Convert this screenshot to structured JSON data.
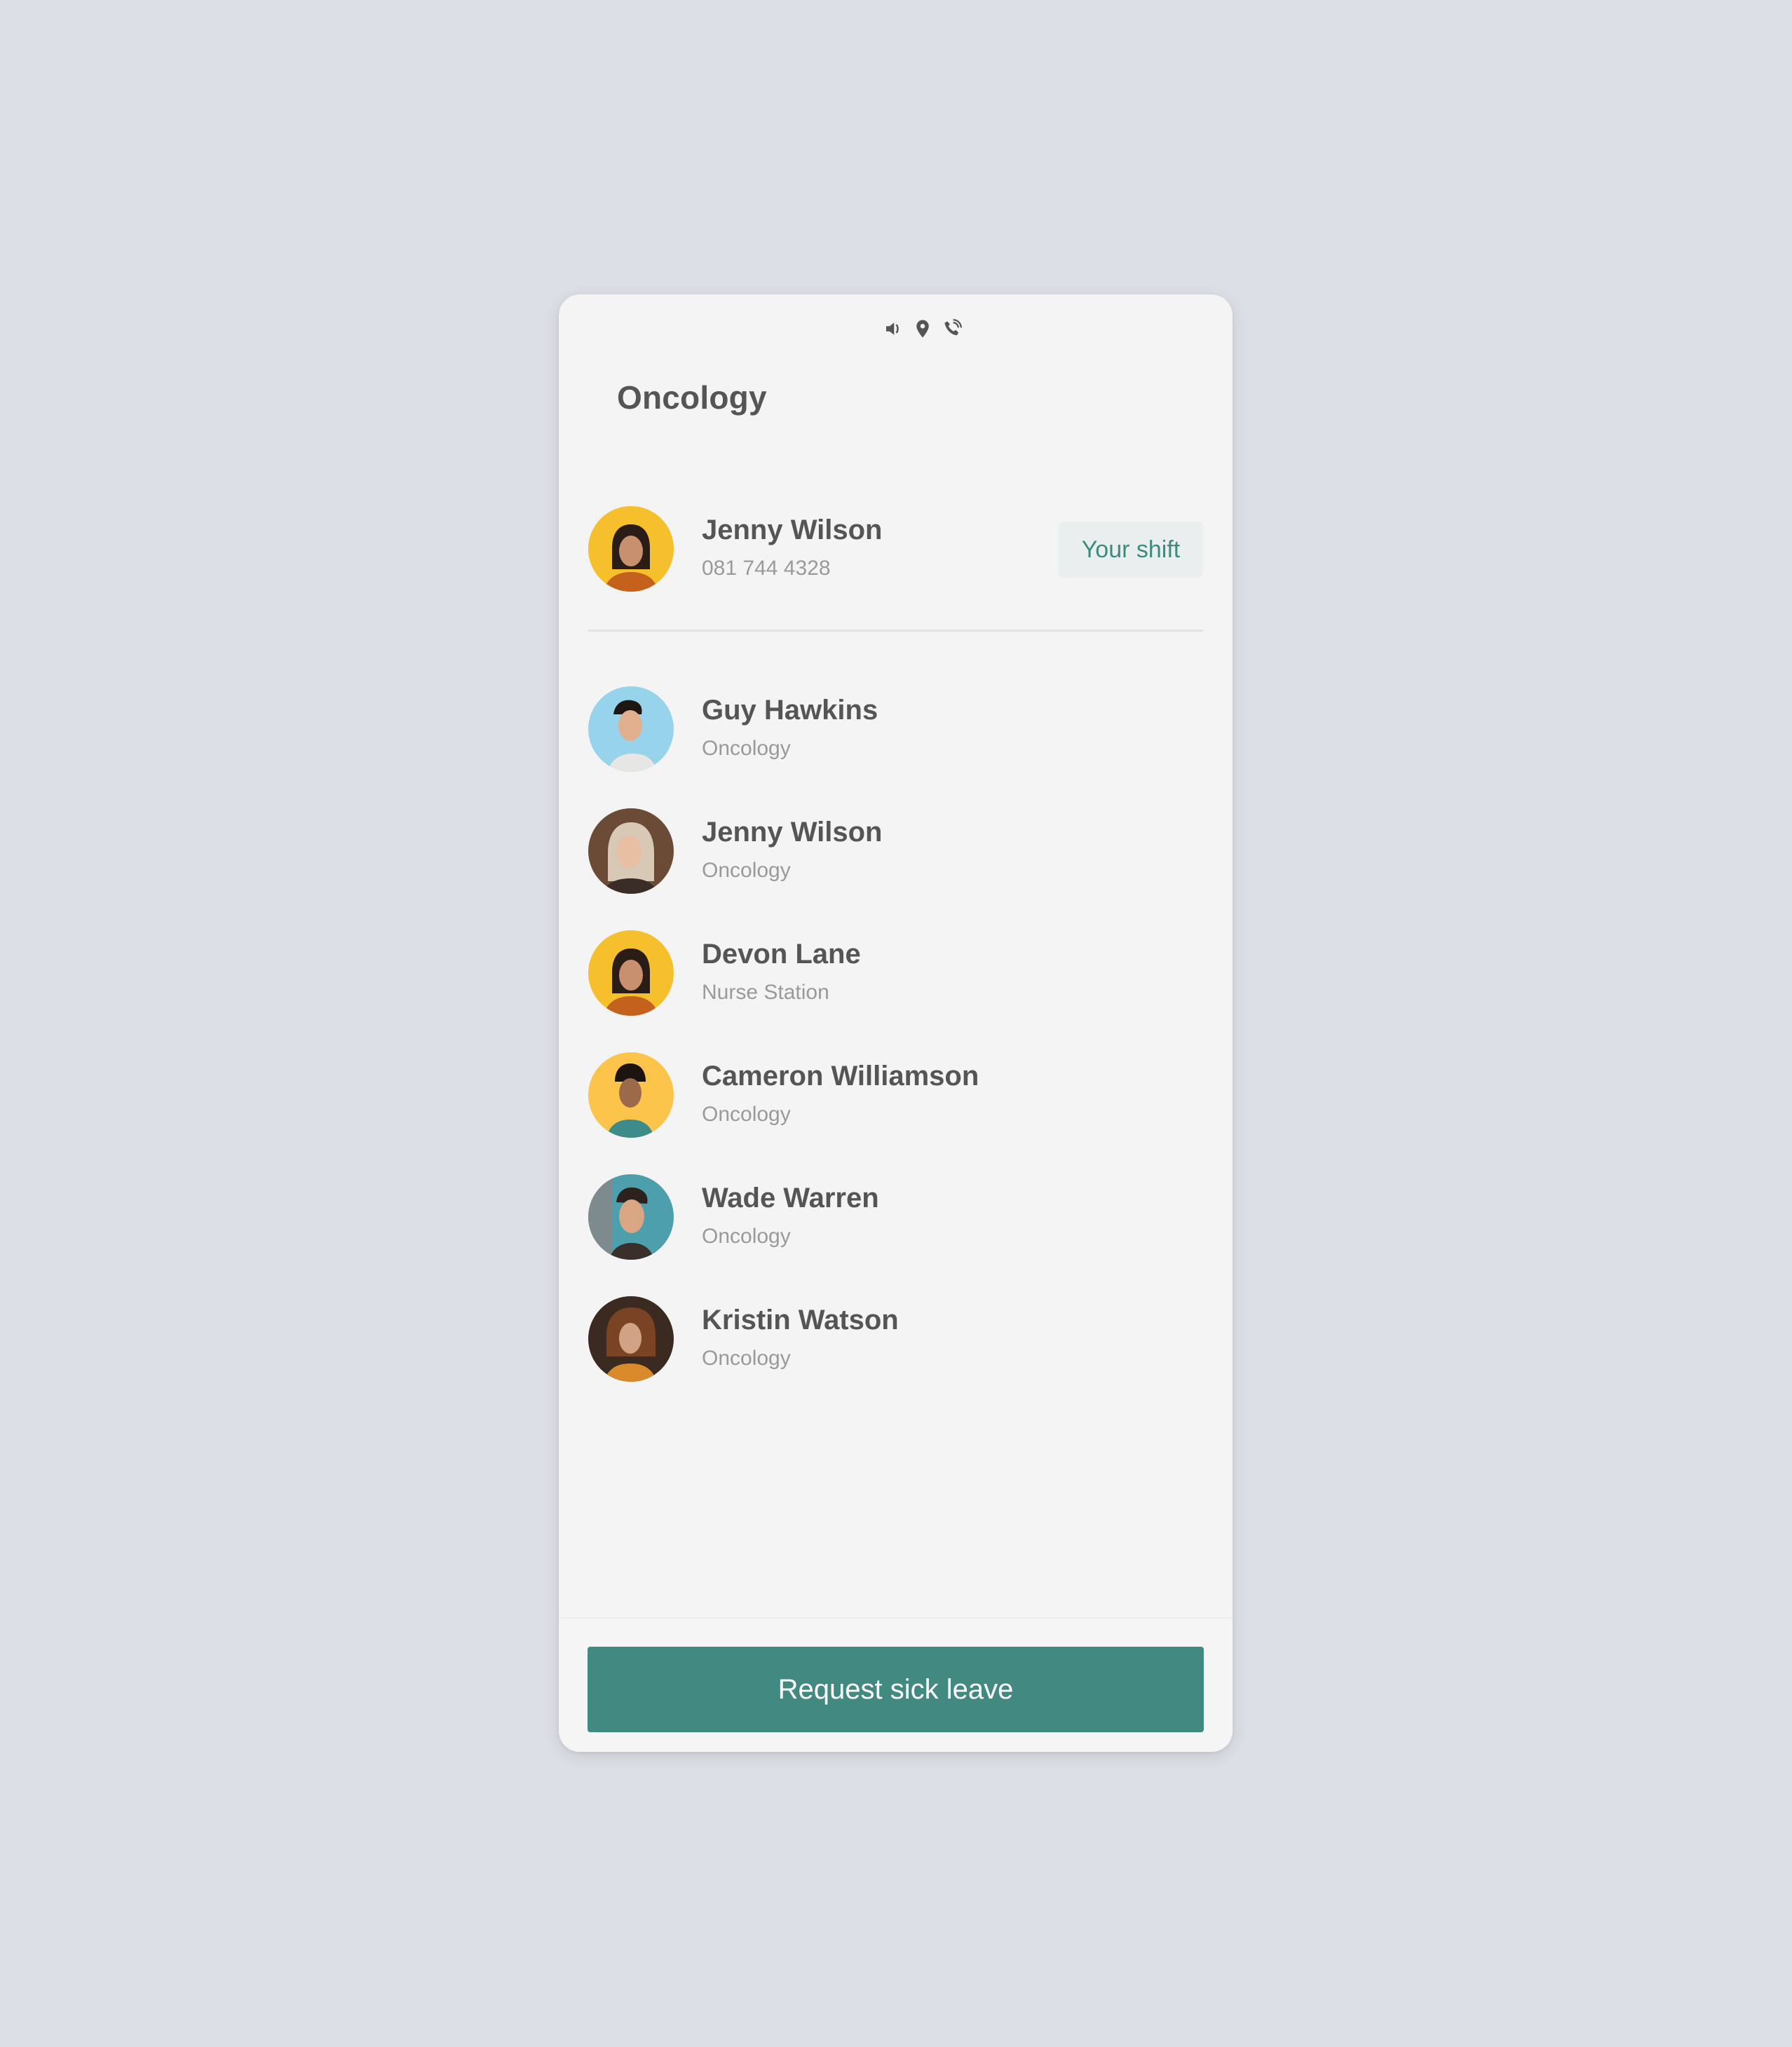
{
  "status_bar": {
    "icons": [
      "speaker-icon",
      "location-pin-icon",
      "phone-ringing-icon"
    ]
  },
  "header": {
    "title": "Oncology"
  },
  "current_user": {
    "name": "Jenny Wilson",
    "phone": "081 744 4328",
    "badge": "Your shift",
    "avatar_bg": "#f6c02d"
  },
  "staff": [
    {
      "name": "Guy Hawkins",
      "department": "Oncology",
      "avatar_bg": "#97d3ea"
    },
    {
      "name": "Jenny Wilson",
      "department": "Oncology",
      "avatar_bg": "#b9a28c"
    },
    {
      "name": "Devon Lane",
      "department": "Nurse Station",
      "avatar_bg": "#f6c02d"
    },
    {
      "name": "Cameron Williamson",
      "department": "Oncology",
      "avatar_bg": "#fdc44c"
    },
    {
      "name": "Wade Warren",
      "department": "Oncology",
      "avatar_bg": "#4e9fae"
    },
    {
      "name": "Kristin Watson",
      "department": "Oncology",
      "avatar_bg": "#3a2a20"
    }
  ],
  "footer": {
    "button_label": "Request sick leave"
  },
  "colors": {
    "accent": "#428a81",
    "badge_bg": "#e9efee",
    "badge_text": "#3e8a7f",
    "background": "#dcdfe6",
    "card": "#f4f4f4"
  }
}
